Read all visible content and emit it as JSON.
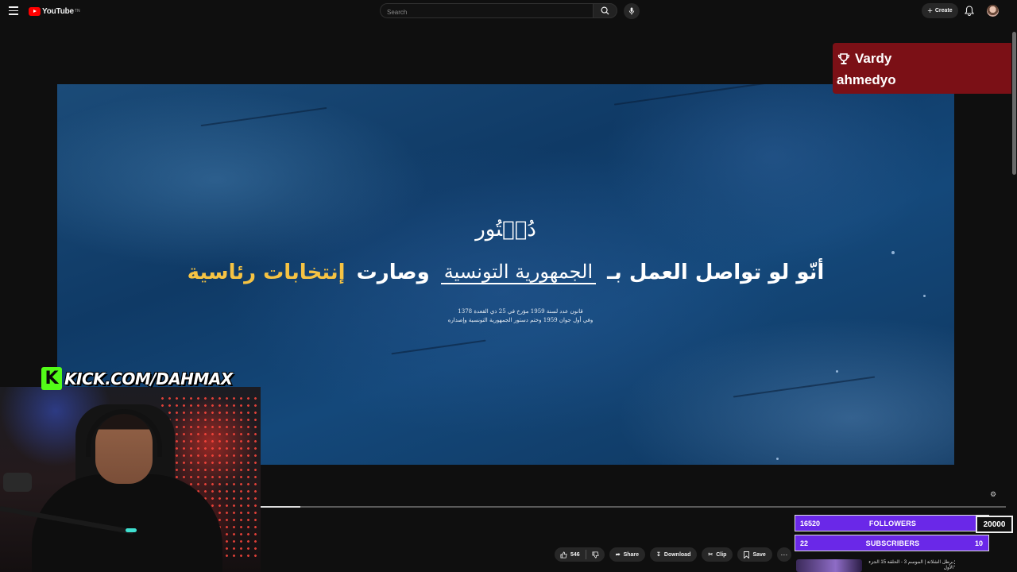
{
  "header": {
    "logo_text": "YouTube",
    "logo_tm": "TN",
    "search_placeholder": "Search",
    "create_label": "Create",
    "icons": [
      "menu-icon",
      "search-icon",
      "mic-icon",
      "plus-icon",
      "bell-icon",
      "avatar"
    ]
  },
  "video": {
    "overlay_word": "دُسۡتُور",
    "headline": {
      "part1": "أنّو لو تواصل العمل بـ",
      "emblem": "الجمهورية التونسية",
      "part2": "وصارت",
      "highlight": "إنتخابات رئاسية"
    },
    "small_lines": [
      "قانون عدد لسنة 1959 مؤرخ في 25 ذي القعدة 1378",
      "وفي أول جوان 1959 وختم دستور الجمهورية التونسية وإصداره"
    ],
    "progress_fraction": 0.053
  },
  "actions": {
    "like_count": "546",
    "share_label": "Share",
    "download_label": "Download",
    "clip_label": "Clip",
    "save_label": "Save"
  },
  "sidebar": {
    "next_title": "برطل الشلاثة | الموسم 3 - الحلقة 15 الجزء الأول"
  },
  "stream": {
    "alert_line1": "Vardy",
    "alert_line2": "ahmedyo",
    "kick_letter": "K",
    "kick_url": "KICK.COM/DAHMAX",
    "followers_count": "16520",
    "followers_label": "FOLLOWERS",
    "followers_goal": "20000",
    "subscribers_count": "22",
    "subscribers_label": "SUBSCRIBERS",
    "subscribers_goal": "10",
    "followers_progress": 0.826,
    "colors": {
      "counter": "#6a28e8",
      "alert": "#7b1016",
      "kick": "#53fc18"
    }
  }
}
